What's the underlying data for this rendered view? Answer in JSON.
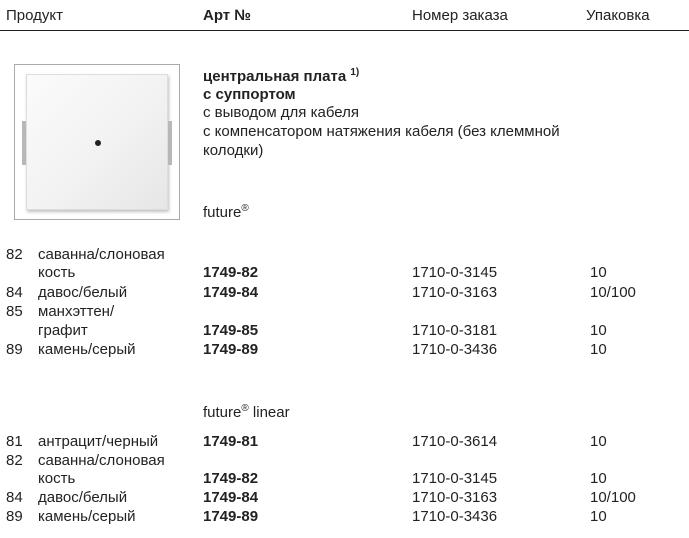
{
  "header": {
    "product": "Продукт",
    "art": "Арт №",
    "order": "Номер заказа",
    "pack": "Упаковка"
  },
  "description": {
    "title": "центральная плата",
    "footnote": "1)",
    "subtitle": "с суппортом",
    "line1": "с выводом для кабеля",
    "line2": "с компенсатором натяжения кабеля (без клеммной",
    "line3": "колодки)"
  },
  "series1": {
    "name": "future",
    "mark": "®",
    "rows": [
      {
        "code": "82",
        "name": "саванна/слоновая",
        "name2": "кость",
        "art": "1749-82",
        "order": "1710-0-3145",
        "pack": "10"
      },
      {
        "code": "84",
        "name": "давос/белый",
        "art": "1749-84",
        "order": "1710-0-3163",
        "pack": "10/100"
      },
      {
        "code": "85",
        "name": "манхэттен/",
        "name2": "графит",
        "art": "1749-85",
        "order": "1710-0-3181",
        "pack": "10"
      },
      {
        "code": "89",
        "name": "камень/серый",
        "art": "1749-89",
        "order": "1710-0-3436",
        "pack": "10"
      }
    ]
  },
  "series2": {
    "name": "future",
    "mark": "®",
    "suffix": " linear",
    "rows": [
      {
        "code": "81",
        "name": "антрацит/черный",
        "art": "1749-81",
        "order": "1710-0-3614",
        "pack": "10"
      },
      {
        "code": "82",
        "name": "саванна/слоновая",
        "name2": "кость",
        "art": "1749-82",
        "order": "1710-0-3145",
        "pack": "10"
      },
      {
        "code": "84",
        "name": "давос/белый",
        "art": "1749-84",
        "order": "1710-0-3163",
        "pack": "10/100"
      },
      {
        "code": "89",
        "name": "камень/серый",
        "art": "1749-89",
        "order": "1710-0-3436",
        "pack": "10"
      }
    ]
  }
}
